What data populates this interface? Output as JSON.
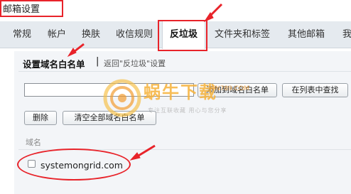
{
  "page_title": "邮箱设置",
  "tabs": [
    {
      "label": "常规"
    },
    {
      "label": "帐户"
    },
    {
      "label": "换肤"
    },
    {
      "label": "收信规则"
    },
    {
      "label": "反垃圾"
    },
    {
      "label": "文件夹和标签"
    },
    {
      "label": "其他邮箱"
    },
    {
      "label": "我"
    }
  ],
  "active_tab": "反垃圾",
  "section": {
    "title": "设置域名白名单",
    "separator": "|",
    "back_link": "返回\"反垃圾\"设置"
  },
  "domain_input": {
    "value": "",
    "placeholder": ""
  },
  "buttons": {
    "add": "添加到域名白名单",
    "find": "在列表中查找",
    "delete": "删除",
    "clear_all": "清空全部域名白名单"
  },
  "list": {
    "column_header": "域名",
    "rows": [
      {
        "domain": "systemongrid.com",
        "checked": false
      }
    ]
  },
  "watermark": {
    "brand": "蜗牛下载",
    "url": "WN789.COM",
    "slogan": "专注互联收藏  用心与您分享"
  },
  "colors": {
    "annotation_red": "#e8232a",
    "tab_bar": "#e5eaef",
    "content_bg": "#f3f5f8"
  }
}
